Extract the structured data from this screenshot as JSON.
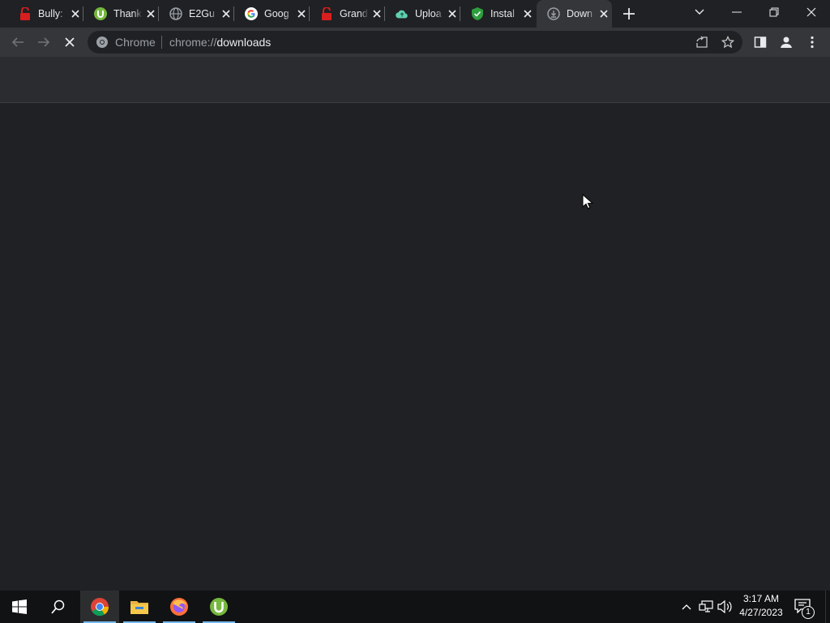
{
  "tabs": [
    {
      "title": "Bully:",
      "icon": "red-lock-icon"
    },
    {
      "title": "Thank",
      "icon": "utorrent-icon"
    },
    {
      "title": "E2Gu",
      "icon": "globe-icon"
    },
    {
      "title": "Goog",
      "icon": "google-icon"
    },
    {
      "title": "Grand",
      "icon": "red-lock-icon"
    },
    {
      "title": "Uploa",
      "icon": "cloud-icon"
    },
    {
      "title": "Instal",
      "icon": "green-shield-icon"
    },
    {
      "title": "Down",
      "icon": "download-icon"
    }
  ],
  "active_tab_index": 7,
  "omnibox": {
    "site_label": "Chrome",
    "url_scheme": "chrome://",
    "url_path": "downloads"
  },
  "taskbar": {
    "apps": [
      "start-icon",
      "search-icon",
      "chrome-icon",
      "file-explorer-icon",
      "firefox-icon",
      "utorrent-icon"
    ],
    "time": "3:17 AM",
    "date": "4/27/2023",
    "notification_count": "1"
  },
  "colors": {
    "background": "#202124",
    "toolbar": "#35363a",
    "accent": "#76b9ed"
  }
}
